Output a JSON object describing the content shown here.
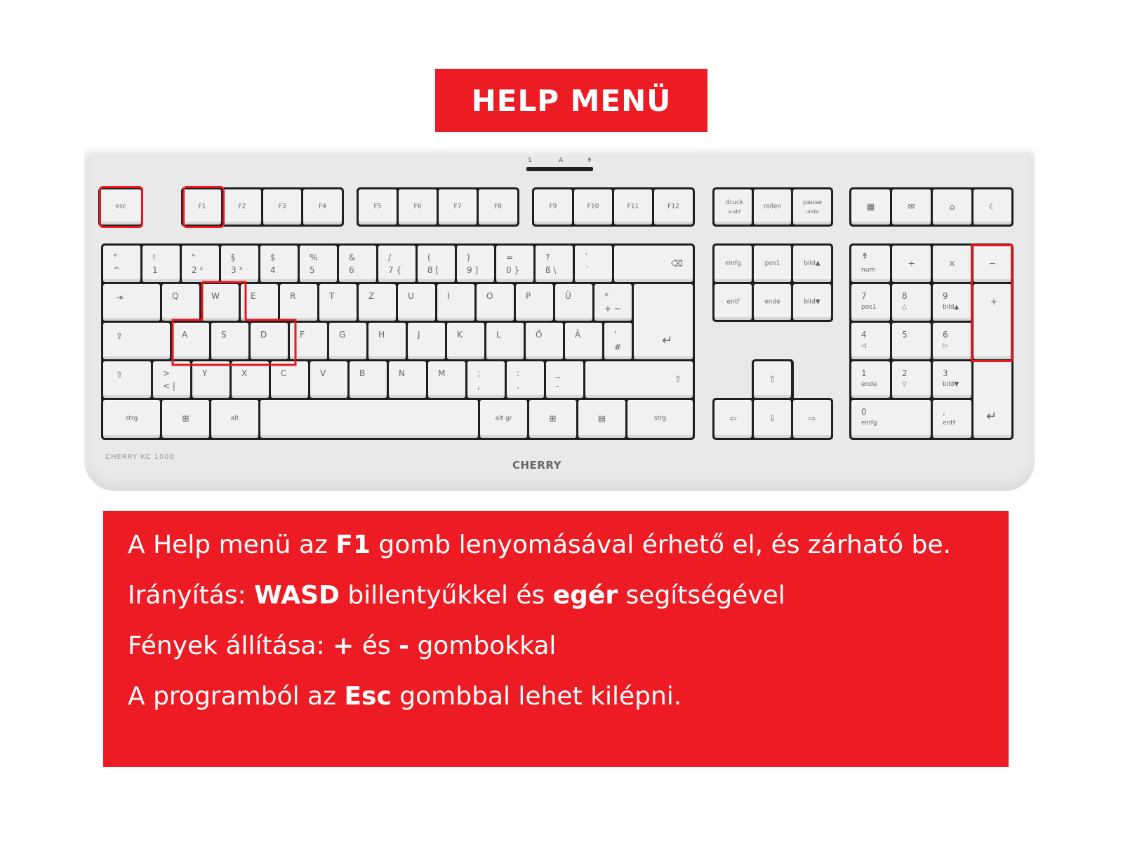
{
  "title": "HELP MENÜ",
  "keyboard": {
    "brand": "CHERRY",
    "model": "CHERRY KC 1000",
    "leds": [
      "1",
      "A",
      "⇞"
    ],
    "fn_row": [
      "esc",
      "F1",
      "F2",
      "F3",
      "F4",
      "F5",
      "F6",
      "F7",
      "F8",
      "F9",
      "F10",
      "F11",
      "F12"
    ],
    "sys_keys": [
      [
        "druck",
        "s-abf"
      ],
      [
        "rollen",
        ""
      ],
      [
        "pause",
        "untbr"
      ]
    ],
    "media_icons": [
      "calculator-icon",
      "mail-icon",
      "home-icon",
      "sleep-icon"
    ],
    "row1": [
      [
        "°",
        "^"
      ],
      [
        "!",
        "1"
      ],
      [
        "\"",
        "2 ²"
      ],
      [
        "§",
        "3 ³"
      ],
      [
        "$",
        "4"
      ],
      [
        "%",
        "5"
      ],
      [
        "&",
        "6"
      ],
      [
        "/",
        "7 {"
      ],
      [
        "(",
        "8 ["
      ],
      [
        ")",
        "9 ]"
      ],
      [
        "=",
        "0 }"
      ],
      [
        "?",
        "ß \\"
      ],
      [
        "`",
        "´"
      ]
    ],
    "row2": [
      "Q",
      "W",
      "E",
      "R",
      "T",
      "Z",
      "U",
      "I",
      "O",
      "P",
      "Ü",
      [
        "*",
        "+ ~"
      ]
    ],
    "row3": [
      "A",
      "S",
      "D",
      "F",
      "G",
      "H",
      "J",
      "K",
      "L",
      "Ö",
      "Ä",
      [
        "'",
        "#"
      ]
    ],
    "row4": [
      [
        ">",
        "< |"
      ],
      "Y",
      "X",
      "C",
      "V",
      "B",
      "N",
      "M",
      [
        ";",
        ","
      ],
      [
        ":",
        "."
      ],
      [
        "_",
        "-"
      ]
    ],
    "row5": [
      "strg",
      "alt",
      "alt gr",
      "strg"
    ],
    "nav1": [
      "einfg",
      "pos1",
      "bild▲"
    ],
    "nav2": [
      "entf",
      "ende",
      "bild▼"
    ],
    "numpad": {
      "r1": [
        "num",
        "÷",
        "×",
        "−"
      ],
      "r2": [
        [
          "7",
          "pos1"
        ],
        [
          "8",
          "△"
        ],
        [
          "9",
          "bild▲"
        ],
        "+"
      ],
      "r3": [
        [
          "4",
          "◁"
        ],
        [
          "5",
          ""
        ],
        [
          "6",
          "▷"
        ]
      ],
      "r4": [
        [
          "1",
          "ende"
        ],
        [
          "2",
          "▽"
        ],
        [
          "3",
          "bild▼"
        ]
      ],
      "r5": [
        [
          "0",
          "einfg"
        ],
        [
          ",",
          "entf"
        ]
      ]
    }
  },
  "info": {
    "line1": {
      "a": "A Help menü az ",
      "b": "F1",
      "c": " gomb lenyomásával érhető el, és zárható be."
    },
    "line2": {
      "a": "Irányítás: ",
      "b": "WASD",
      "c": " billentyűkkel és ",
      "d": "egér",
      "e": " segítségével"
    },
    "line3": {
      "a": "Fények állítása: ",
      "b": "+",
      "c": " és ",
      "d": "-",
      "e": " gombokkal"
    },
    "line4": {
      "a": "A programból az ",
      "b": "Esc",
      "c": " gombbal lehet kilépni."
    }
  },
  "colors": {
    "accent": "#ed1c24",
    "keyboard": "#e9e9e9",
    "key": "#f1f1f1"
  }
}
